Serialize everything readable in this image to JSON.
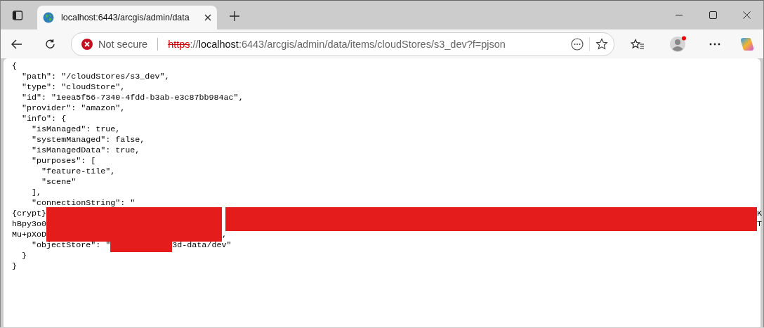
{
  "tab": {
    "title": "localhost:6443/arcgis/admin/data",
    "selected": true
  },
  "address_bar": {
    "security": "Not secure",
    "scheme": "https",
    "separator": "://",
    "host": "localhost",
    "rest": ":6443/arcgis/admin/data/items/cloudStores/s3_dev?f=pjson"
  },
  "json_lines": [
    [
      {
        "kind": "text",
        "text": "{"
      }
    ],
    [
      {
        "kind": "text",
        "text": "  \"path\": \"/cloudStores/s3_dev\","
      }
    ],
    [
      {
        "kind": "text",
        "text": "  \"type\": \"cloudStore\","
      }
    ],
    [
      {
        "kind": "text",
        "text": "  \"id\": \"1eea5f56-7340-4fdd-b3ab-e3c87bb984ac\","
      }
    ],
    [
      {
        "kind": "text",
        "text": "  \"provider\": \"amazon\","
      }
    ],
    [
      {
        "kind": "text",
        "text": "  \"info\": {"
      }
    ],
    [
      {
        "kind": "text",
        "text": "    \"isManaged\": true,"
      }
    ],
    [
      {
        "kind": "text",
        "text": "    \"systemManaged\": false,"
      }
    ],
    [
      {
        "kind": "text",
        "text": "    \"isManagedData\": true,"
      }
    ],
    [
      {
        "kind": "text",
        "text": "    \"purposes\": ["
      }
    ],
    [
      {
        "kind": "text",
        "text": "      \"feature-tile\","
      }
    ],
    [
      {
        "kind": "text",
        "text": "      \"scene\""
      }
    ],
    [
      {
        "kind": "text",
        "text": "    ],"
      }
    ],
    [
      {
        "kind": "text",
        "text": "    \"connectionString\": \""
      }
    ],
    [
      {
        "kind": "text",
        "text": "{crypt}"
      },
      {
        "kind": "redaction"
      },
      {
        "kind": "redaction-wide"
      },
      {
        "kind": "text",
        "text": "K"
      }
    ],
    [
      {
        "kind": "text",
        "text": "hBpy3o0"
      },
      {
        "kind": "redaction"
      },
      {
        "kind": "redaction-wide"
      },
      {
        "kind": "text",
        "text": "T"
      }
    ],
    [
      {
        "kind": "text",
        "text": "Mu+pXoD"
      },
      {
        "kind": "redaction"
      },
      {
        "kind": "text",
        "text": ","
      }
    ],
    [
      {
        "kind": "text",
        "text": "    \"objectStore\": \""
      },
      {
        "kind": "redaction-short"
      },
      {
        "kind": "text",
        "text": "3d-data/dev\""
      }
    ],
    [
      {
        "kind": "text",
        "text": "  }"
      }
    ],
    [
      {
        "kind": "text",
        "text": "}"
      }
    ]
  ]
}
